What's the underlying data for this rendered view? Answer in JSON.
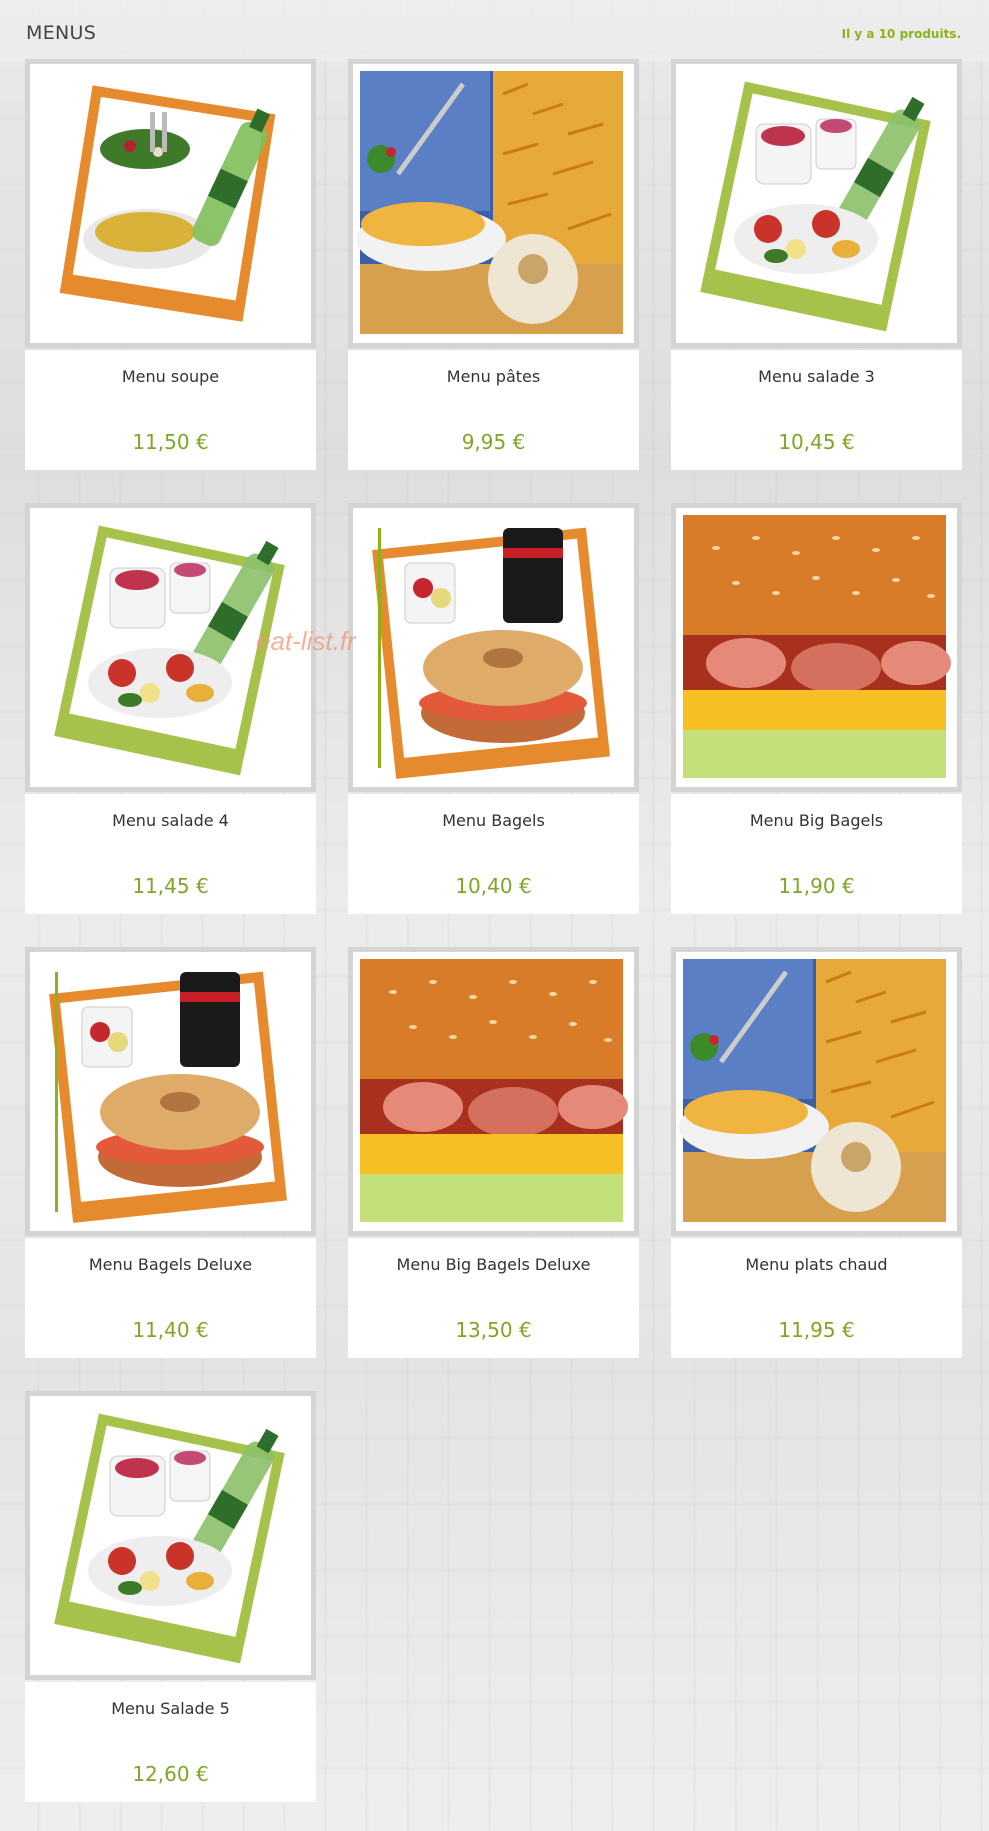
{
  "header": {
    "title": "MENUS",
    "count": "Il y a 10 produits."
  },
  "watermark": "eat-list.fr",
  "colors": {
    "price": "#7fa624",
    "count": "#8bb21a",
    "frame": "#d4d4d4"
  },
  "products": [
    {
      "name": "Menu soupe",
      "price": "11,50 €",
      "image": "soup-salad-water-photo"
    },
    {
      "name": "Menu pâtes",
      "price": "9,95 €",
      "image": "pasta-garlic-photo"
    },
    {
      "name": "Menu salade 3",
      "price": "10,45 €",
      "image": "salad-yogurt-water-photo"
    },
    {
      "name": "Menu salade 4",
      "price": "11,45 €",
      "image": "salad-yogurt-water-photo"
    },
    {
      "name": "Menu Bagels",
      "price": "10,40 €",
      "image": "bagel-cola-photo"
    },
    {
      "name": "Menu Big Bagels",
      "price": "11,90 €",
      "image": "big-bagel-closeup-photo"
    },
    {
      "name": "Menu Bagels Deluxe",
      "price": "11,40 €",
      "image": "bagel-cola-photo"
    },
    {
      "name": "Menu Big Bagels Deluxe",
      "price": "13,50 €",
      "image": "big-bagel-closeup-photo"
    },
    {
      "name": "Menu plats chaud",
      "price": "11,95 €",
      "image": "pasta-garlic-photo"
    },
    {
      "name": "Menu Salade 5",
      "price": "12,60 €",
      "image": "salad-yogurt-water-photo"
    }
  ]
}
